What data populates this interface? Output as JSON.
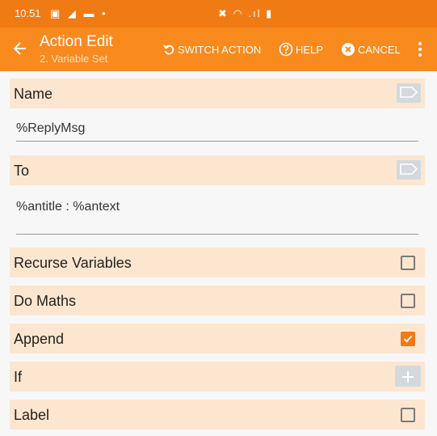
{
  "status_bar": {
    "time": "10:51",
    "left_icons": "▣ ◢ ▬ •",
    "right_icons": "✖ ◠ .ıl ▮"
  },
  "toolbar": {
    "title": "Action Edit",
    "subtitle": "2. Variable Set",
    "switch_action_label": "SWITCH ACTION",
    "help_label": "HELP",
    "cancel_label": "CANCEL"
  },
  "fields": {
    "name": {
      "label": "Name",
      "value": "%ReplyMsg"
    },
    "to": {
      "label": "To",
      "value": "%antitle : %antext"
    }
  },
  "options": {
    "recurse_variables": {
      "label": "Recurse Variables",
      "checked": false
    },
    "do_maths": {
      "label": "Do Maths",
      "checked": false
    },
    "append": {
      "label": "Append",
      "checked": true
    },
    "if": {
      "label": "If"
    },
    "label": {
      "label": "Label",
      "checked": false
    }
  },
  "colors": {
    "status_bar": "#f07a14",
    "toolbar": "#f88a1e",
    "row_background": "#fde6cf",
    "accent": "#f07a14",
    "page_background": "#f7f7f7"
  }
}
